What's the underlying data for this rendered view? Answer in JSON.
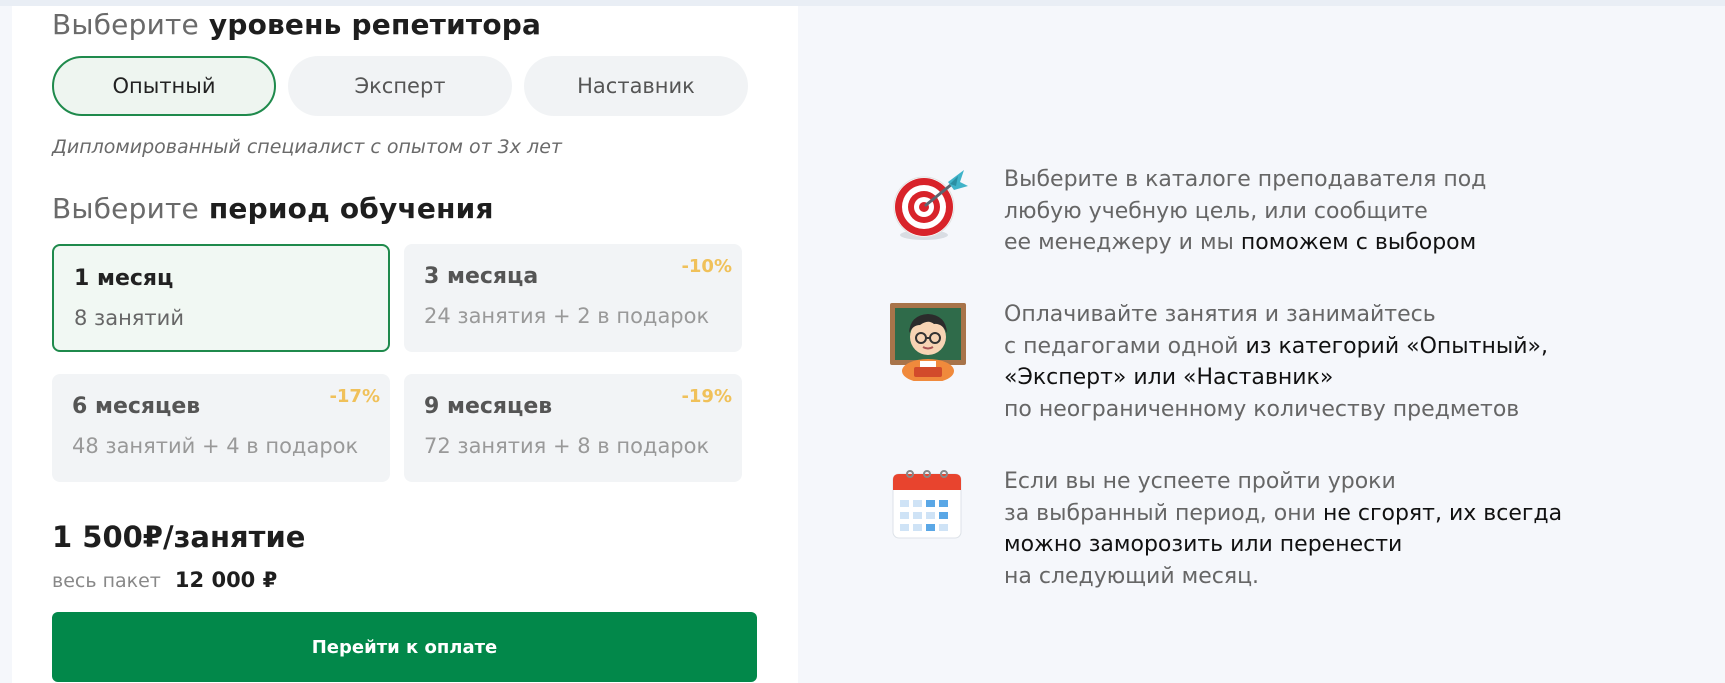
{
  "level": {
    "heading_muted": "Выберите",
    "heading_strong": "уровень репетитора",
    "tabs": [
      {
        "label": "Опытный",
        "active": true
      },
      {
        "label": "Эксперт",
        "active": false
      },
      {
        "label": "Наставник",
        "active": false
      }
    ],
    "description": "Дипломированный специалист с опытом от 3х лет"
  },
  "period": {
    "heading_muted": "Выберите",
    "heading_strong": "период обучения",
    "options": [
      {
        "title": "1 месяц",
        "subtitle": "8 занятий",
        "discount": "",
        "active": true
      },
      {
        "title": "3 месяца",
        "subtitle": "24 занятия + 2 в подарок",
        "discount": "-10%",
        "active": false
      },
      {
        "title": "6 месяцев",
        "subtitle": "48 занятий + 4 в подарок",
        "discount": "-17%",
        "active": false
      },
      {
        "title": "9 месяцев",
        "subtitle": "72 занятия + 8 в подарок",
        "discount": "-19%",
        "active": false
      }
    ]
  },
  "pricing": {
    "per_lesson": "1 500₽/занятие",
    "package_label": "весь пакет",
    "package_amount": "12 000 ₽",
    "pay_button": "Перейти к оплате"
  },
  "features": [
    {
      "icon": "target-dart-icon",
      "lines": [
        [
          {
            "t": "Выберите в каталоге преподавателя под",
            "h": false
          }
        ],
        [
          {
            "t": "любую учебную цель, или сообщите",
            "h": false
          }
        ],
        [
          {
            "t": "ее менеджеру и мы ",
            "h": false
          },
          {
            "t": "поможем с выбором",
            "h": true
          }
        ]
      ]
    },
    {
      "icon": "teacher-icon",
      "lines": [
        [
          {
            "t": "Оплачивайте занятия и занимайтесь",
            "h": false
          }
        ],
        [
          {
            "t": "с педагогами одной ",
            "h": false
          },
          {
            "t": "из категорий «Опытный»,",
            "h": true
          }
        ],
        [
          {
            "t": "«Эксперт» или «Наставник»",
            "h": true
          }
        ],
        [
          {
            "t": "по неограниченному количеству предметов",
            "h": false
          }
        ]
      ]
    },
    {
      "icon": "calendar-icon",
      "lines": [
        [
          {
            "t": "Если вы не успеете пройти уроки",
            "h": false
          }
        ],
        [
          {
            "t": "за выбранный период, они ",
            "h": false
          },
          {
            "t": "не сгорят, их всегда",
            "h": true
          }
        ],
        [
          {
            "t": "можно заморозить или перенести",
            "h": true
          }
        ],
        [
          {
            "t": "на следующий месяц.",
            "h": false
          }
        ]
      ]
    }
  ],
  "colors": {
    "accent_green": "#02884a",
    "active_border": "#1f8a4c",
    "discount": "#f0c15a"
  }
}
